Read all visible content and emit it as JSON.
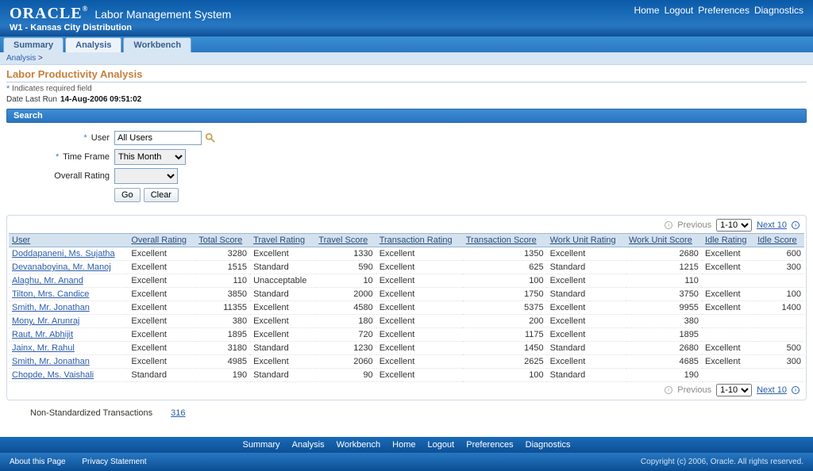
{
  "brand": {
    "logo": "ORACLE",
    "reg": "®",
    "app": "Labor Management System",
    "sub": "W1 - Kansas City Distribution"
  },
  "top_links": {
    "home": "Home",
    "logout": "Logout",
    "prefs": "Preferences",
    "diag": "Diagnostics"
  },
  "tabs": {
    "summary": "Summary",
    "analysis": "Analysis",
    "workbench": "Workbench"
  },
  "crumb": {
    "a": "Analysis",
    "sep": ">"
  },
  "page": {
    "title": "Labor Productivity Analysis",
    "req": "Indicates required field",
    "runlbl": "Date Last Run",
    "runval": "14-Aug-2006 09:51:02"
  },
  "search": {
    "head": "Search",
    "userLbl": "User",
    "userVal": "All Users",
    "tfLbl": "Time Frame",
    "tfVal": "This Month",
    "orLbl": "Overall Rating",
    "orVal": "",
    "go": "Go",
    "clear": "Clear"
  },
  "pager": {
    "prev": "Previous",
    "range": "1-10",
    "next": "Next 10"
  },
  "cols": {
    "user": "User",
    "or": "Overall Rating",
    "ts": "Total Score",
    "tr": "Travel Rating",
    "tvs": "Travel Score",
    "xr": "Transaction Rating",
    "xs": "Transaction Score",
    "wr": "Work Unit Rating",
    "ws": "Work Unit Score",
    "ir": "Idle Rating",
    "is": "Idle Score"
  },
  "rows": [
    {
      "user": "Doddapaneni, Ms. Sujatha",
      "or": "Excellent",
      "ts": 3280,
      "tr": "Excellent",
      "tvs": 1330,
      "xr": "Excellent",
      "xs": 1350,
      "wr": "Excellent",
      "ws": 2680,
      "ir": "Excellent",
      "is": 600
    },
    {
      "user": "Devanaboyina, Mr. Manoj",
      "or": "Excellent",
      "ts": 1515,
      "tr": "Standard",
      "tvs": 590,
      "xr": "Excellent",
      "xs": 625,
      "wr": "Standard",
      "ws": 1215,
      "ir": "Excellent",
      "is": 300
    },
    {
      "user": "Alaghu, Mr. Anand",
      "or": "Excellent",
      "ts": 110,
      "tr": "Unacceptable",
      "tvs": 10,
      "xr": "Excellent",
      "xs": 100,
      "wr": "Excellent",
      "ws": 110,
      "ir": "",
      "is": ""
    },
    {
      "user": "Tilton, Mrs. Candice",
      "or": "Excellent",
      "ts": 3850,
      "tr": "Standard",
      "tvs": 2000,
      "xr": "Excellent",
      "xs": 1750,
      "wr": "Standard",
      "ws": 3750,
      "ir": "Excellent",
      "is": 100
    },
    {
      "user": "Smith, Mr. Jonathan",
      "or": "Excellent",
      "ts": 11355,
      "tr": "Excellent",
      "tvs": 4580,
      "xr": "Excellent",
      "xs": 5375,
      "wr": "Excellent",
      "ws": 9955,
      "ir": "Excellent",
      "is": 1400
    },
    {
      "user": "Mony, Mr. Arunraj",
      "or": "Excellent",
      "ts": 380,
      "tr": "Excellent",
      "tvs": 180,
      "xr": "Excellent",
      "xs": 200,
      "wr": "Excellent",
      "ws": 380,
      "ir": "",
      "is": ""
    },
    {
      "user": "Raut, Mr. Abhijit",
      "or": "Excellent",
      "ts": 1895,
      "tr": "Excellent",
      "tvs": 720,
      "xr": "Excellent",
      "xs": 1175,
      "wr": "Excellent",
      "ws": 1895,
      "ir": "",
      "is": ""
    },
    {
      "user": "Jainx, Mr. Rahul",
      "or": "Excellent",
      "ts": 3180,
      "tr": "Standard",
      "tvs": 1230,
      "xr": "Excellent",
      "xs": 1450,
      "wr": "Standard",
      "ws": 2680,
      "ir": "Excellent",
      "is": 500
    },
    {
      "user": "Smith, Mr. Jonathan",
      "or": "Excellent",
      "ts": 4985,
      "tr": "Excellent",
      "tvs": 2060,
      "xr": "Excellent",
      "xs": 2625,
      "wr": "Excellent",
      "ws": 4685,
      "ir": "Excellent",
      "is": 300
    },
    {
      "user": "Chopde, Ms. Vaishali",
      "or": "Standard",
      "ts": 190,
      "tr": "Standard",
      "tvs": 90,
      "xr": "Excellent",
      "xs": 100,
      "wr": "Standard",
      "ws": 190,
      "ir": "",
      "is": ""
    }
  ],
  "nonstd": {
    "lbl": "Non-Standardized Transactions",
    "val": "316"
  },
  "footnav": {
    "summary": "Summary",
    "analysis": "Analysis",
    "workbench": "Workbench",
    "home": "Home",
    "logout": "Logout",
    "prefs": "Preferences",
    "diag": "Diagnostics"
  },
  "footer": {
    "about": "About this Page",
    "privacy": "Privacy Statement",
    "copy": "Copyright (c) 2006, Oracle. All rights reserved."
  }
}
